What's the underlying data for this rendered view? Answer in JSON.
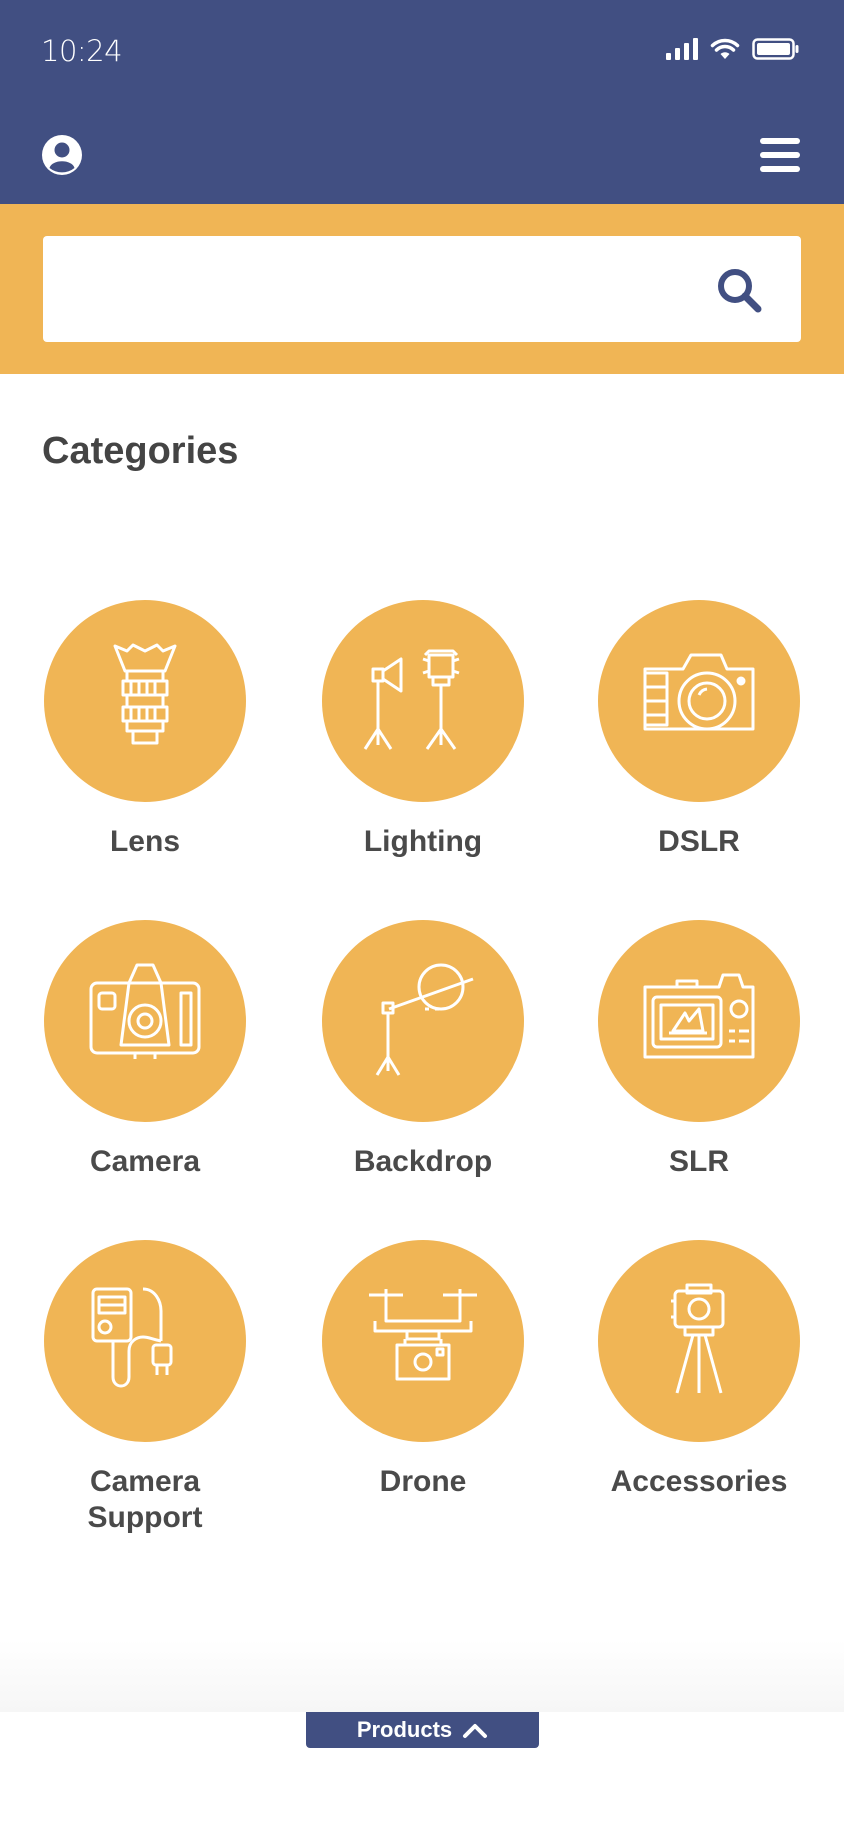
{
  "status_bar": {
    "time": "10:24"
  },
  "search": {
    "placeholder": "",
    "value": ""
  },
  "section_title": "Categories",
  "categories": [
    {
      "label": "Lens",
      "icon": "lens-icon"
    },
    {
      "label": "Lighting",
      "icon": "lighting-icon"
    },
    {
      "label": "DSLR",
      "icon": "dslr-icon"
    },
    {
      "label": "Camera",
      "icon": "camera-icon"
    },
    {
      "label": "Backdrop",
      "icon": "backdrop-icon"
    },
    {
      "label": "SLR",
      "icon": "slr-icon"
    },
    {
      "label": "Camera Support",
      "icon": "camera-support-icon"
    },
    {
      "label": "Drone",
      "icon": "drone-icon"
    },
    {
      "label": "Accessories",
      "icon": "accessories-icon"
    }
  ],
  "bottom_tab": {
    "label": "Products",
    "icon": "chevron-up-icon"
  },
  "colors": {
    "brand": "#414f82",
    "accent": "#f0b555",
    "text": "#4a4a4a"
  }
}
